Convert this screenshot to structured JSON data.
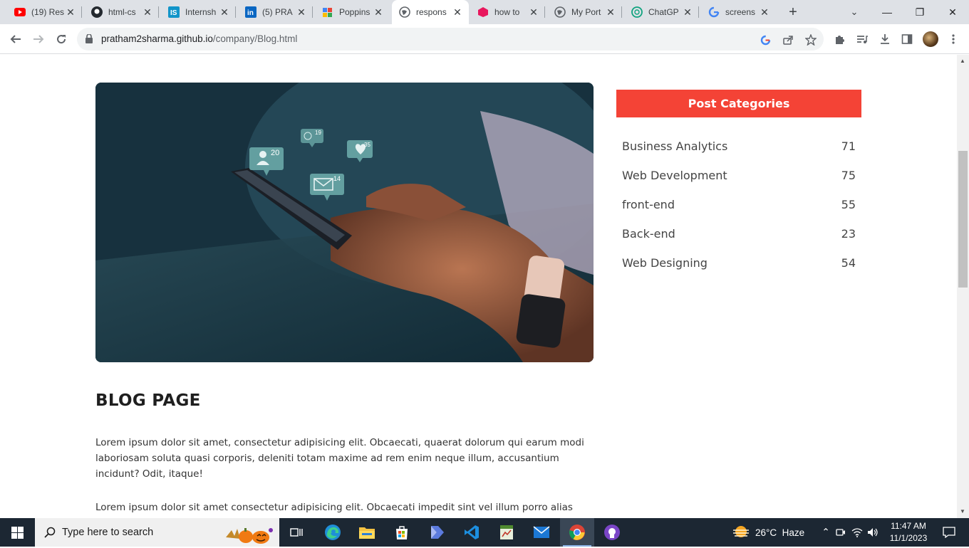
{
  "browser": {
    "tabs": [
      {
        "title": "(19) Res",
        "icon": "youtube-icon"
      },
      {
        "title": "html-cs",
        "icon": "github-icon"
      },
      {
        "title": "Internsh",
        "icon": "internshala-icon"
      },
      {
        "title": "(5) PRA",
        "icon": "linkedin-icon"
      },
      {
        "title": "Poppins",
        "icon": "google-fonts-icon"
      },
      {
        "title": "respons",
        "icon": "globe-icon"
      },
      {
        "title": "how to",
        "icon": "cube-icon"
      },
      {
        "title": "My Port",
        "icon": "globe-icon"
      },
      {
        "title": "ChatGP",
        "icon": "chatgpt-icon"
      },
      {
        "title": "screens",
        "icon": "google-icon"
      }
    ],
    "url_host": "pratham2sharma.github.io",
    "url_path": "/company/Blog.html"
  },
  "page": {
    "notification_badges": [
      "20",
      "19",
      "35",
      "14"
    ],
    "blog_title": "BLOG PAGE",
    "paragraphs": [
      "Lorem ipsum dolor sit amet, consectetur adipisicing elit. Obcaecati, quaerat dolorum qui earum modi laboriosam soluta quasi corporis, deleniti totam maxime ad rem enim neque illum, accusantium incidunt? Odit, itaque!",
      "Lorem ipsum dolor sit amet consectetur adipisicing elit. Obcaecati impedit sint vel illum porro alias"
    ],
    "categories_title": "Post Categories",
    "categories": [
      {
        "name": "Business Analytics",
        "count": "71"
      },
      {
        "name": "Web Development",
        "count": "75"
      },
      {
        "name": "front-end",
        "count": "55"
      },
      {
        "name": "Back-end",
        "count": "23"
      },
      {
        "name": "Web Designing",
        "count": "54"
      }
    ],
    "accent_color": "#f44336"
  },
  "taskbar": {
    "search_placeholder": "Type here to search",
    "weather": "26°C  Haze",
    "time": "11:47 AM",
    "date": "11/1/2023"
  }
}
